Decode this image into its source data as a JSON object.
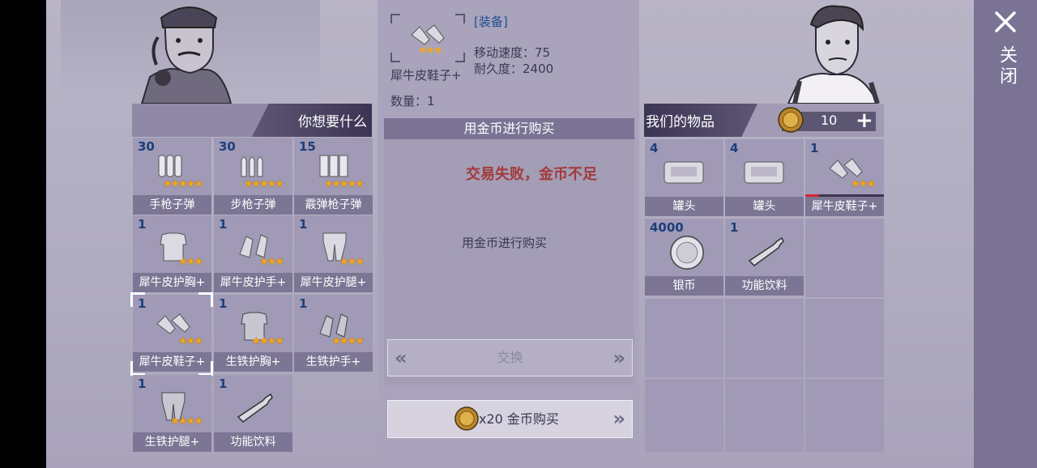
{
  "close": {
    "label": "关闭"
  },
  "want": {
    "title": "你想要什么",
    "items": [
      {
        "qty": "30",
        "label": "手枪子弹",
        "stars": "★★★★★",
        "icon": "pistol-ammo-icon"
      },
      {
        "qty": "30",
        "label": "步枪子弹",
        "stars": "★★★★★",
        "icon": "rifle-ammo-icon"
      },
      {
        "qty": "15",
        "label": "霰弹枪子弹",
        "stars": "★★★★★",
        "icon": "shotgun-ammo-icon"
      },
      {
        "qty": "1",
        "label": "犀牛皮护胸+",
        "stars": "★★★",
        "icon": "chest-armor-icon"
      },
      {
        "qty": "1",
        "label": "犀牛皮护手+",
        "stars": "★★★",
        "icon": "gloves-icon"
      },
      {
        "qty": "1",
        "label": "犀牛皮护腿+",
        "stars": "★★★",
        "icon": "leg-armor-icon"
      },
      {
        "qty": "1",
        "label": "犀牛皮鞋子+",
        "stars": "★★★",
        "icon": "boots-icon"
      },
      {
        "qty": "1",
        "label": "生铁护胸+",
        "stars": "★★★★",
        "icon": "iron-chest-icon"
      },
      {
        "qty": "1",
        "label": "生铁护手+",
        "stars": "★★★★",
        "icon": "iron-gloves-icon"
      },
      {
        "qty": "1",
        "label": "生铁护腿+",
        "stars": "★★★★",
        "icon": "iron-legs-icon"
      },
      {
        "qty": "1",
        "label": "功能饮料",
        "stars": "",
        "icon": "energy-drink-icon"
      }
    ]
  },
  "selected": {
    "name": "犀牛皮鞋子+",
    "category": "[装备]",
    "speed": "移动速度：75",
    "durability": "耐久度：2400",
    "quantity": "数量：1",
    "stars": "★★★"
  },
  "middle": {
    "bar_title": "用金币进行购买",
    "error": "交易失败，金币不足",
    "note": "用金币进行购买",
    "exchange": "交换",
    "buy": "x20 金币购买"
  },
  "ours": {
    "title": "我们的物品",
    "coins": "10",
    "items": [
      {
        "qty": "4",
        "label": "罐头",
        "icon": "can-icon"
      },
      {
        "qty": "4",
        "label": "罐头",
        "icon": "can-icon"
      },
      {
        "qty": "1",
        "label": "犀牛皮鞋子+",
        "stars": "★★★",
        "icon": "boots-icon",
        "durability": 0.18
      },
      {
        "qty": "4000",
        "label": "银币",
        "icon": "silver-coin-icon"
      },
      {
        "qty": "1",
        "label": "功能饮料",
        "icon": "energy-drink-icon"
      }
    ]
  },
  "colors": {
    "accent_qty": "#1d3f7a",
    "error": "#a33a3a",
    "star": "#f6a719",
    "durability": "#d0282e"
  }
}
